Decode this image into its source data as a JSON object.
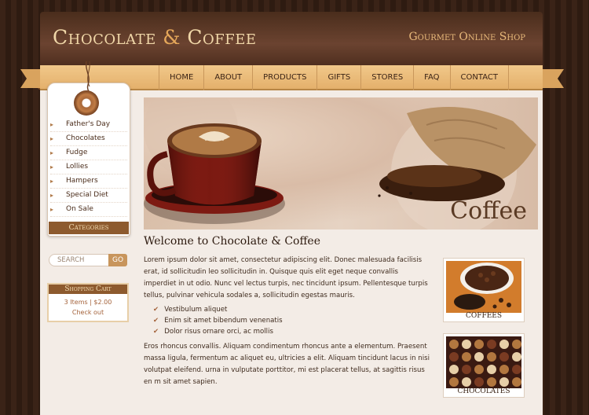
{
  "header": {
    "title_part1": "Chocolate",
    "title_amp": "&",
    "title_part2": "Coffee",
    "tagline": "Gourmet Online Shop"
  },
  "nav": {
    "items": [
      {
        "label": "HOME"
      },
      {
        "label": "ABOUT"
      },
      {
        "label": "PRODUCTS"
      },
      {
        "label": "GIFTS"
      },
      {
        "label": "STORES"
      },
      {
        "label": "FAQ"
      },
      {
        "label": "CONTACT"
      }
    ]
  },
  "sidebar": {
    "categories": [
      {
        "label": "Father's Day"
      },
      {
        "label": "Chocolates"
      },
      {
        "label": "Fudge"
      },
      {
        "label": "Lollies"
      },
      {
        "label": "Hampers"
      },
      {
        "label": "Special Diet"
      },
      {
        "label": "On Sale"
      }
    ],
    "categories_title": "Categories",
    "search": {
      "placeholder": "SEARCH",
      "button_label": "GO"
    },
    "cart": {
      "title": "Shopping Cart",
      "summary": "3 Items | $2.00",
      "checkout_label": "Check out"
    }
  },
  "hero": {
    "label": "Coffee"
  },
  "main": {
    "heading": "Welcome to Chocolate & Coffee",
    "paragraph1": "Lorem ipsum dolor sit amet, consectetur adipiscing elit. Donec malesuada facilisis erat, id sollicitudin leo sollicitudin in. Quisque quis elit eget neque convallis imperdiet in ut odio. Nunc vel lectus turpis, nec tincidunt ipsum. Pellentesque turpis tellus, pulvinar vehicula sodales a, sollicitudin egestas mauris.",
    "bullets": [
      "Vestibulum aliquet",
      "Enim sit amet bibendum venenatis",
      "Dolor risus ornare orci, ac mollis"
    ],
    "paragraph2": "Eros rhoncus convallis. Aliquam condimentum rhoncus ante a elementum. Praesent massa ligula, fermentum ac aliquet eu, ultricies a elit. Aliquam tincidunt lacus in nisi volutpat eleifend. urna in vulputate porttitor, mi est placerat tellus, at sagittis risus en m sit amet sapien."
  },
  "products": [
    {
      "caption": "COFFEES"
    },
    {
      "caption": "CHOCOLATES"
    }
  ],
  "colors": {
    "brown_dark": "#3a2317",
    "accent": "#e5a75a",
    "nav_bg": "#e4b06c",
    "banner": "#8d5a2e"
  }
}
